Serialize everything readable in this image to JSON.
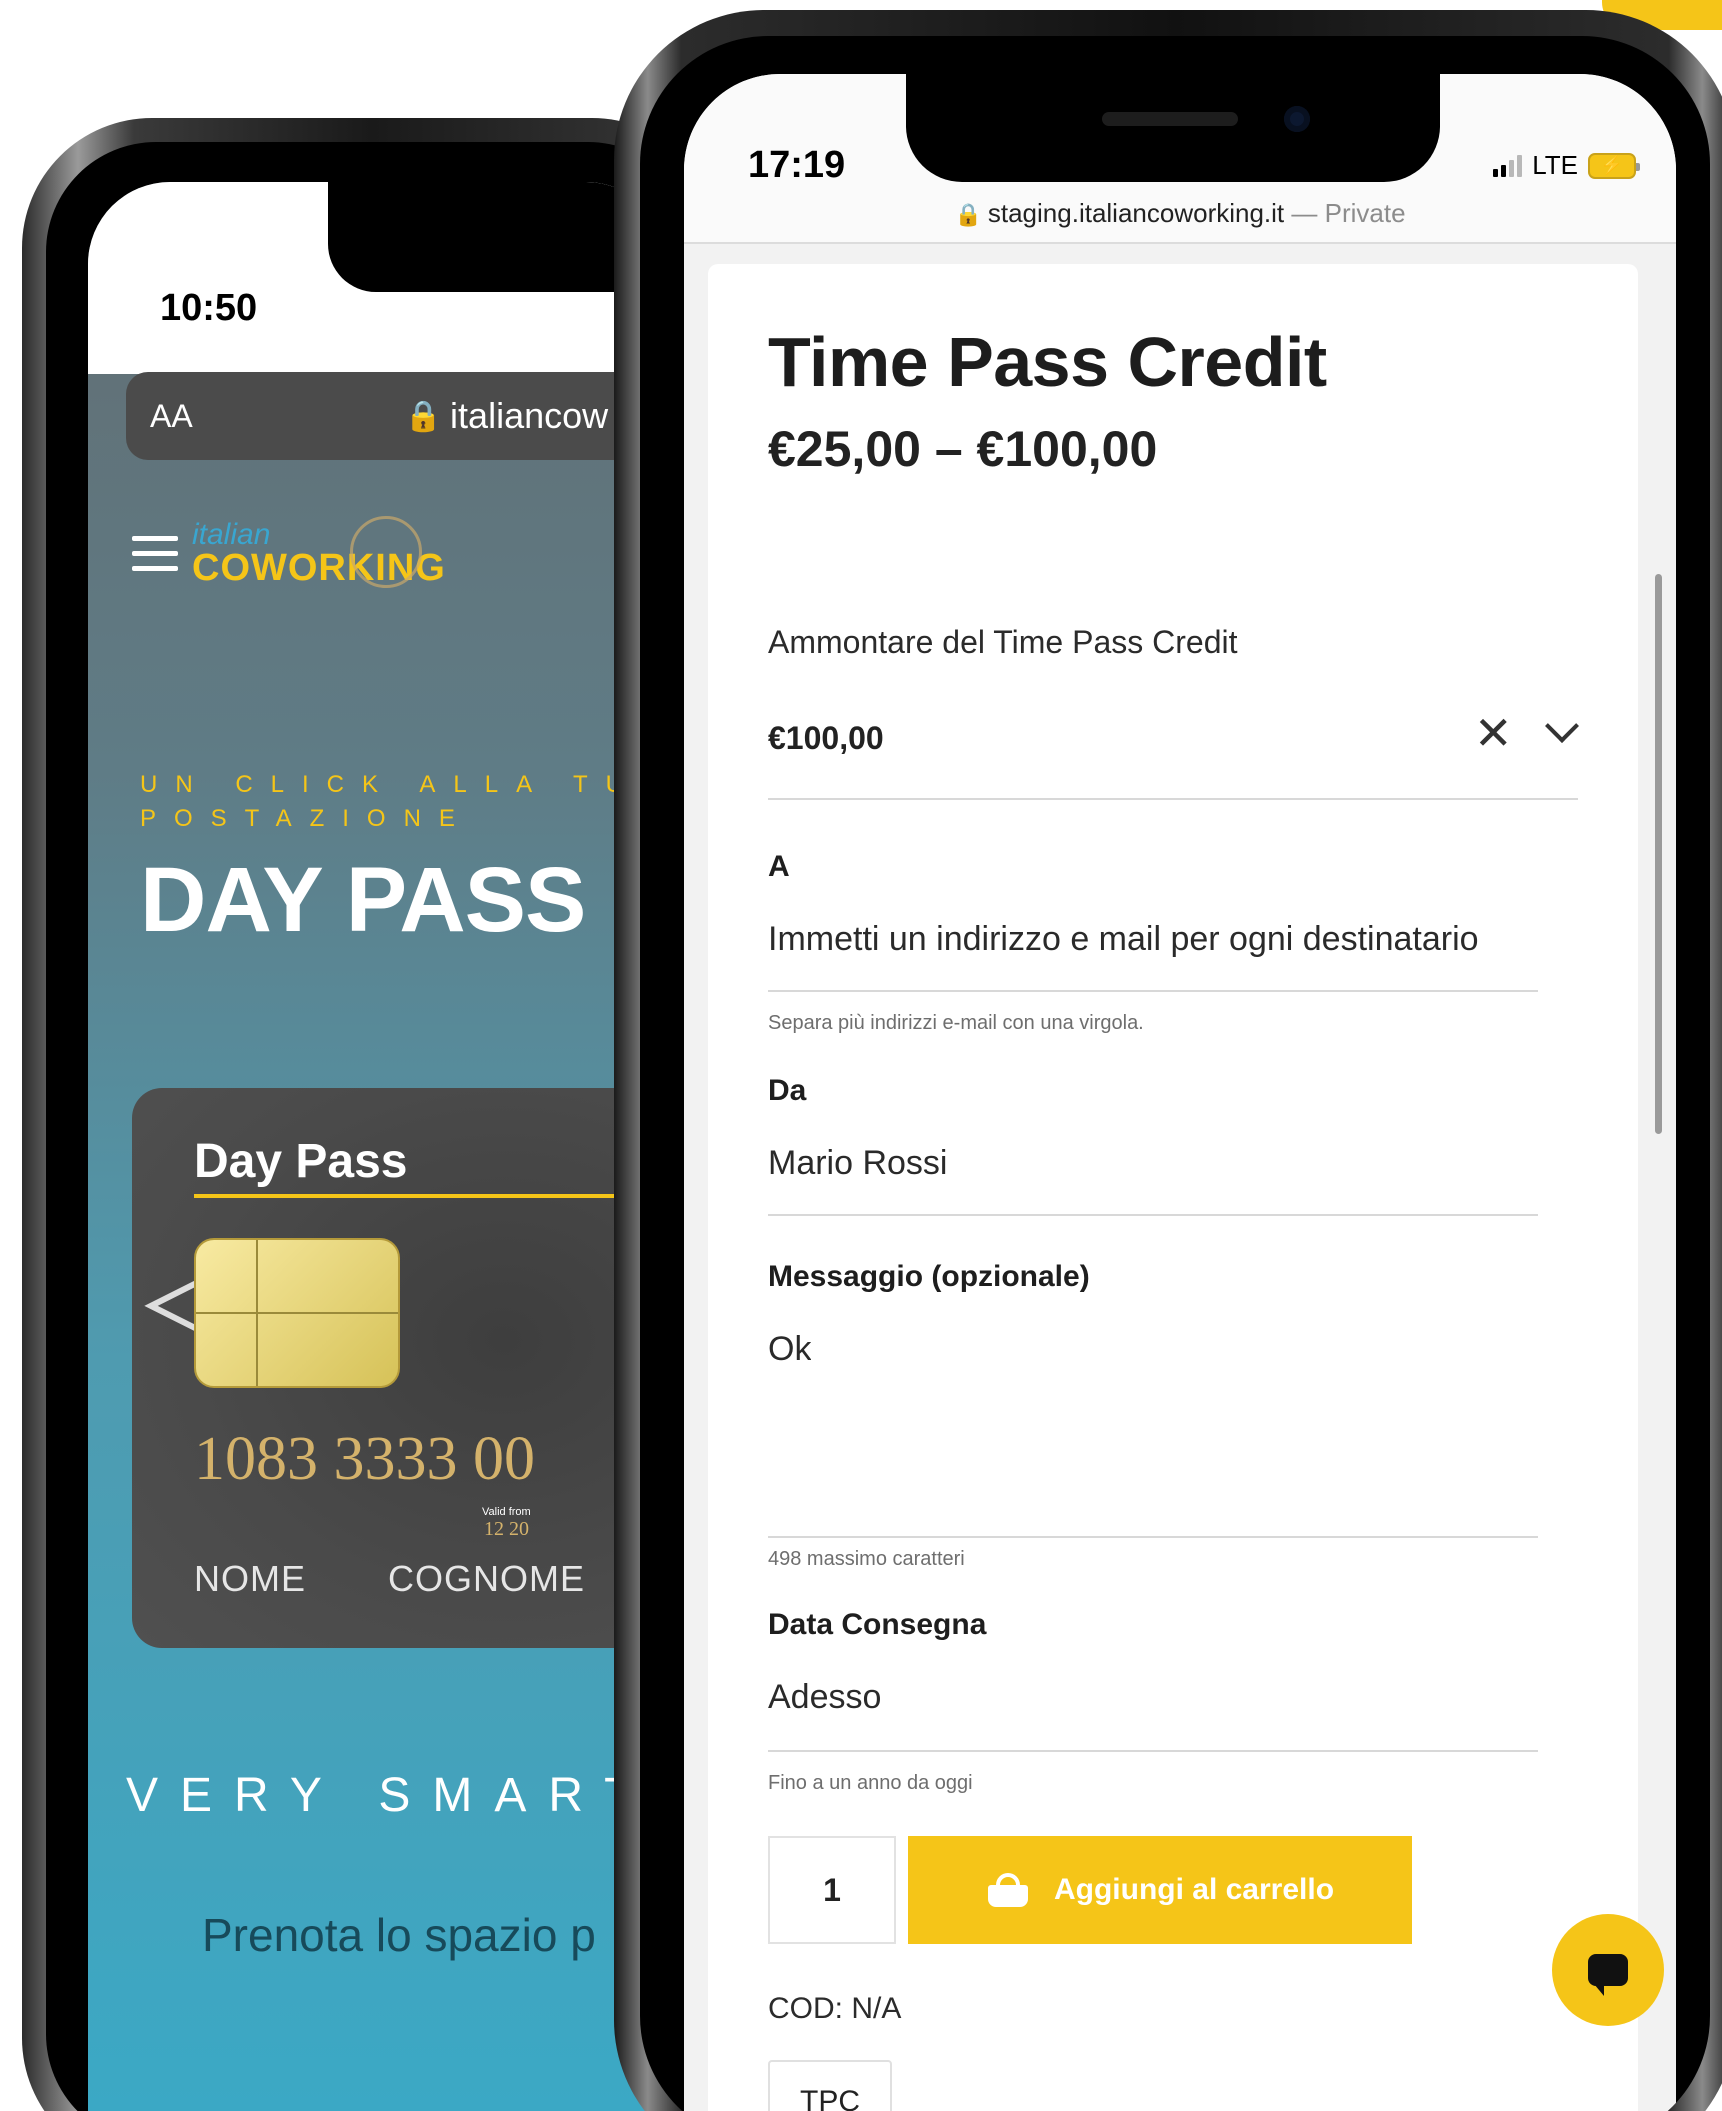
{
  "back_phone": {
    "status_time": "10:50",
    "url_bar": {
      "aa": "AA",
      "host": "italiancow"
    },
    "site": {
      "logo_top": "italian",
      "logo_bottom": "COWORKING",
      "tagline_line1": "UN CLICK ALLA TUA",
      "tagline_line2": "POSTAZIONE",
      "hero_title": "DAY PASS",
      "card": {
        "title": "Day Pass",
        "number": "1083 3333 00",
        "valid_label": "Valid from",
        "valid_date": "12 20",
        "name": "NOME",
        "surname": "COGNOME"
      },
      "section_title": "VERY SMART",
      "cta_text": "Prenota lo spazio p"
    }
  },
  "front_phone": {
    "status_time": "17:19",
    "network": "LTE",
    "battery_glyph": "⚡",
    "url": {
      "host": "staging.italiancoworking.it",
      "separator": " — ",
      "mode": "Private"
    },
    "product": {
      "title": "Time Pass Credit",
      "price_range": "€25,00 – €100,00",
      "amount_label": "Ammontare del Time Pass Credit",
      "amount_value": "€100,00",
      "to_label": "A",
      "to_placeholder": "Immetti un indirizzo e mail per ogni destinatario",
      "to_help": "Separa più indirizzi e-mail con una virgola.",
      "from_label": "Da",
      "from_value": "Mario Rossi",
      "message_label": "Messaggio (opzionale)",
      "message_value": "Ok",
      "message_help": "498 massimo caratteri",
      "delivery_label": "Data Consegna",
      "delivery_value": "Adesso",
      "delivery_help": "Fino a un anno da oggi",
      "quantity": "1",
      "add_to_cart": "Aggiungi al carrello",
      "sku": "COD: N/A",
      "tag": "TPC"
    }
  },
  "colors": {
    "accent": "#f5c518",
    "text": "#1e1e1e",
    "teal_bg": "#3aa9c6"
  },
  "icons": [
    "lock-icon",
    "close-icon",
    "chevron-down-icon",
    "basket-icon",
    "chat-icon",
    "hamburger-icon",
    "signal-icon",
    "battery-icon"
  ]
}
